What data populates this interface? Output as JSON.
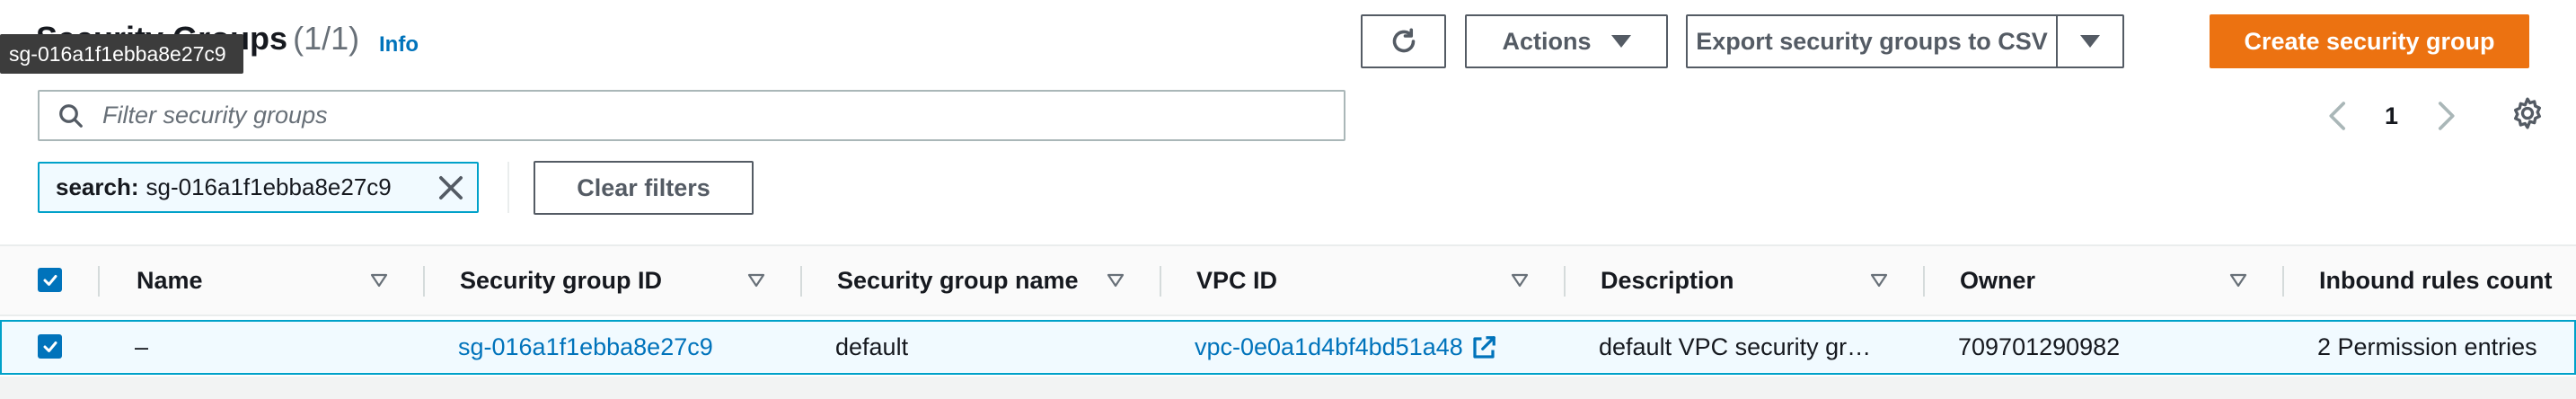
{
  "header": {
    "title": "Security Groups",
    "count": "(1/1)",
    "info": "Info",
    "tooltip": "sg-016a1f1ebba8e27c9"
  },
  "toolbar": {
    "refresh_icon": "refresh-icon",
    "actions_label": "Actions",
    "export_label": "Export security groups to CSV",
    "create_label": "Create security group"
  },
  "search": {
    "placeholder": "Filter security groups",
    "token_key": "search:",
    "token_value": "sg-016a1f1ebba8e27c9",
    "clear_label": "Clear filters"
  },
  "pagination": {
    "current_page": "1"
  },
  "table": {
    "columns": [
      "Name",
      "Security group ID",
      "Security group name",
      "VPC ID",
      "Description",
      "Owner",
      "Inbound rules count"
    ],
    "rows": [
      {
        "selected": true,
        "name": "–",
        "security_group_id": "sg-016a1f1ebba8e27c9",
        "security_group_name": "default",
        "vpc_id": "vpc-0e0a1d4bf4bd51a48",
        "description": "default VPC security gr…",
        "owner": "709701290982",
        "inbound_rules_count": "2 Permission entries"
      }
    ]
  },
  "colors": {
    "primary": "#ec7211",
    "link": "#0073bb",
    "selected_border": "#00a1c9",
    "selected_bg": "#f1faff"
  }
}
